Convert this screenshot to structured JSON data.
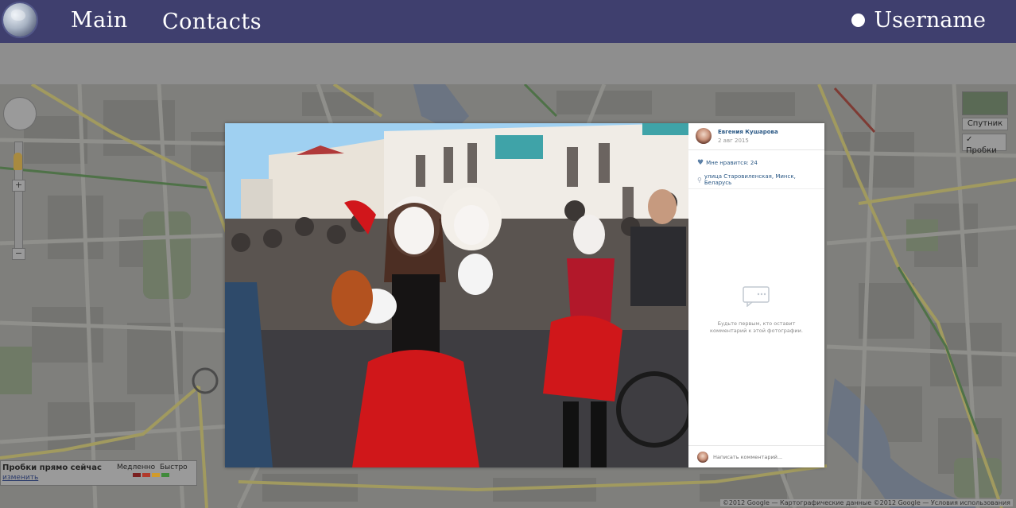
{
  "nav": {
    "main_label": "Main",
    "contacts_label": "Contacts",
    "username": "Username"
  },
  "map": {
    "maptype_label": "Спутник",
    "traffic_toggle_label": "✓ Пробки",
    "traffic_title": "Пробки прямо сейчас",
    "traffic_link": "изменить",
    "traffic_slow": "Медленно",
    "traffic_fast": "Быстро",
    "traffic_colors": [
      "#7a1f1f",
      "#b23a2b",
      "#d19b2a",
      "#3f8a3a"
    ],
    "copyright": "©2012 Google — Картографические данные ©2012 Google — Условия использования"
  },
  "photo_viewer": {
    "author_name": "Евгения Кушарова",
    "date": "2 авг 2015",
    "likes_text": "Мне нравится: 24",
    "place_text": "улица Старовиленская, Минск, Беларусь",
    "empty_comments_text": "Будьте первым, кто оставит комментарий к этой фотографии.",
    "comment_placeholder": "Написать комментарий..."
  },
  "colors": {
    "nav_bg": "#3f3f6e",
    "link_blue": "#2a5885"
  }
}
